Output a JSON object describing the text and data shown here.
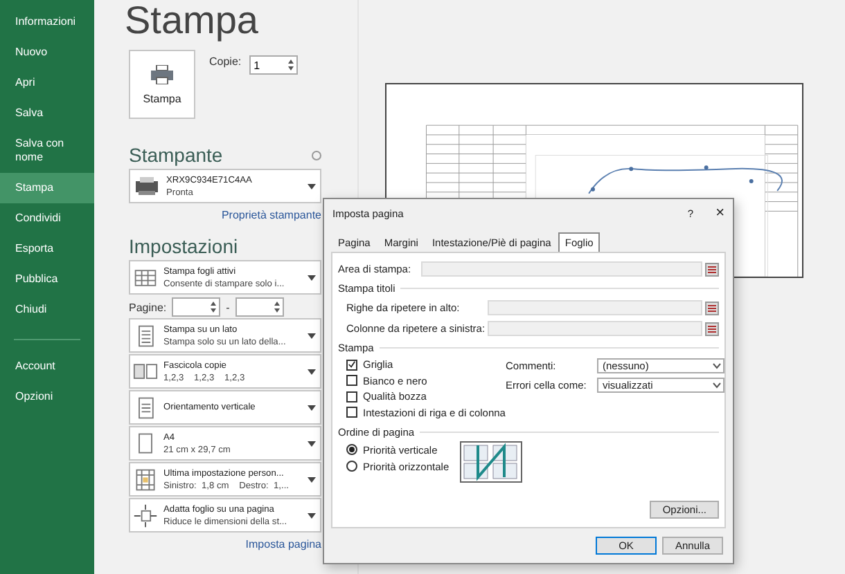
{
  "sidebar": {
    "items": [
      {
        "label": "Informazioni",
        "selected": false
      },
      {
        "label": "Nuovo",
        "selected": false
      },
      {
        "label": "Apri",
        "selected": false
      },
      {
        "label": "Salva",
        "selected": false
      },
      {
        "label": "Salva con nome",
        "selected": false
      },
      {
        "label": "Stampa",
        "selected": true
      },
      {
        "label": "Condividi",
        "selected": false
      },
      {
        "label": "Esporta",
        "selected": false
      },
      {
        "label": "Pubblica",
        "selected": false
      },
      {
        "label": "Chiudi",
        "selected": false
      }
    ],
    "bottom_items": [
      {
        "label": "Account",
        "selected": false
      },
      {
        "label": "Opzioni",
        "selected": false
      }
    ]
  },
  "print": {
    "title": "Stampa",
    "button": "Stampa",
    "copies_label": "Copie:",
    "copies": "1",
    "printer_heading": "Stampante",
    "printer": {
      "name": "XRX9C934E71C4AA",
      "status": "Pronta"
    },
    "printer_link": "Proprietà stampante",
    "settings_heading": "Impostazioni",
    "settings": [
      {
        "kind": "sheets",
        "title": "Stampa fogli attivi",
        "subtitle": "Consente di stampare solo i..."
      },
      {
        "kind": "pages",
        "label": "Pagine:",
        "separator": "-"
      },
      {
        "kind": "sides",
        "title": "Stampa su un lato",
        "subtitle": "Stampa solo su un lato della..."
      },
      {
        "kind": "collate",
        "title": "Fascicola copie",
        "subtitle": "1,2,3    1,2,3    1,2,3"
      },
      {
        "kind": "orientation",
        "title": "Orientamento verticale"
      },
      {
        "kind": "paper",
        "title": "A4",
        "subtitle": "21 cm x 29,7 cm"
      },
      {
        "kind": "margins",
        "title": "Ultima impostazione person...",
        "subtitle": "Sinistro:  1,8 cm    Destro:  1,..."
      },
      {
        "kind": "scaling",
        "title": "Adatta foglio su una pagina",
        "subtitle": "Riduce le dimensioni della st..."
      }
    ],
    "setup_link": "Imposta pagina"
  },
  "dialog": {
    "title": "Imposta pagina",
    "help": "?",
    "close": "×",
    "tabs": [
      {
        "label": "Pagina",
        "selected": false
      },
      {
        "label": "Margini",
        "selected": false
      },
      {
        "label": "Intestazione/Piè di pagina",
        "selected": false
      },
      {
        "label": "Foglio",
        "selected": true
      }
    ],
    "print_area_label": "Area di stampa:",
    "titles_heading": "Stampa titoli",
    "title_fields": [
      {
        "label": "Righe da ripetere in alto:"
      },
      {
        "label": "Colonne da ripetere a sinistra:"
      }
    ],
    "print_heading": "Stampa",
    "checkboxes": [
      {
        "label": "Griglia",
        "checked": true
      },
      {
        "label": "Bianco e nero",
        "checked": false
      },
      {
        "label": "Qualità bozza",
        "checked": false
      },
      {
        "label": "Intestazioni di riga e di colonna",
        "checked": false
      }
    ],
    "selects": [
      {
        "label": "Commenti:",
        "value": "(nessuno)"
      },
      {
        "label": "Errori cella come:",
        "value": "visualizzati"
      }
    ],
    "order_heading": "Ordine di pagina",
    "radios": [
      {
        "label": "Priorità verticale",
        "selected": true
      },
      {
        "label": "Priorità orizzontale",
        "selected": false
      }
    ],
    "options_button": "Opzioni...",
    "ok": "OK",
    "cancel": "Annulla"
  }
}
